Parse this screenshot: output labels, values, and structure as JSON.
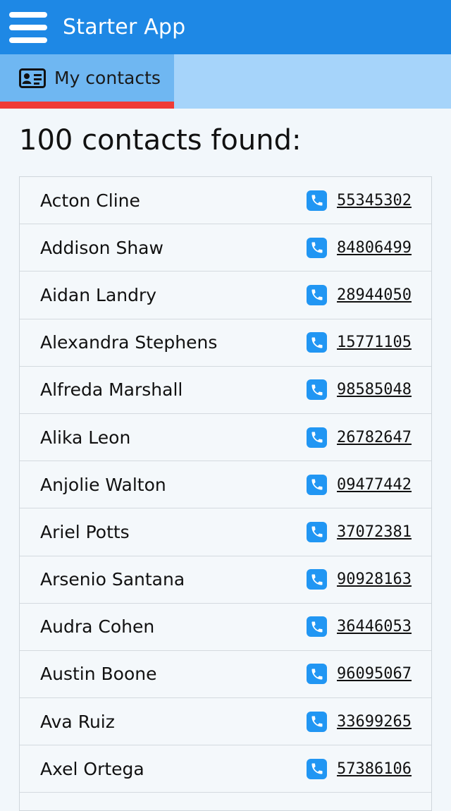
{
  "appbar": {
    "title": "Starter App"
  },
  "tabs": [
    {
      "label": "My contacts",
      "icon": "contact-card-icon",
      "active": true
    }
  ],
  "heading": "100 contacts found:",
  "contacts": [
    {
      "name": "Acton Cline",
      "phone": "55345302"
    },
    {
      "name": "Addison Shaw",
      "phone": "84806499"
    },
    {
      "name": "Aidan Landry",
      "phone": "28944050"
    },
    {
      "name": "Alexandra Stephens",
      "phone": "15771105"
    },
    {
      "name": "Alfreda Marshall",
      "phone": "98585048"
    },
    {
      "name": "Alika Leon",
      "phone": "26782647"
    },
    {
      "name": "Anjolie Walton",
      "phone": "09477442"
    },
    {
      "name": "Ariel Potts",
      "phone": "37072381"
    },
    {
      "name": "Arsenio Santana",
      "phone": "90928163"
    },
    {
      "name": "Audra Cohen",
      "phone": "36446053"
    },
    {
      "name": "Austin Boone",
      "phone": "96095067"
    },
    {
      "name": "Ava Ruiz",
      "phone": "33699265"
    },
    {
      "name": "Axel Ortega",
      "phone": "57386106"
    }
  ],
  "colors": {
    "appbar": "#1e88e5",
    "tabbar": "#a6d4fa",
    "tab_active": "#6fb7f2",
    "tab_indicator": "#ef3b36",
    "phone_icon": "#2196f3"
  }
}
